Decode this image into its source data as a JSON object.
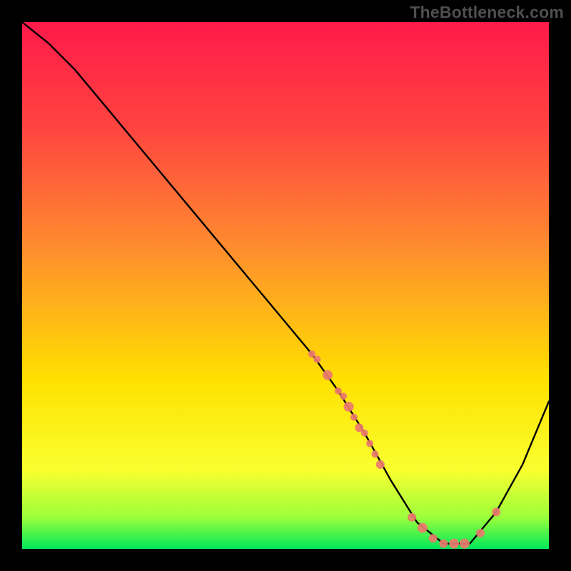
{
  "watermark": "TheBottleneck.com",
  "chart_data": {
    "type": "line",
    "title": "",
    "xlabel": "",
    "ylabel": "",
    "xlim": [
      0,
      100
    ],
    "ylim": [
      0,
      100
    ],
    "grid": false,
    "legend": false,
    "background_gradient": {
      "top_color": "#ff1a4a",
      "mid_color": "#ffe100",
      "bottom_color": "#00e85a"
    },
    "series": [
      {
        "name": "bottleneck-curve",
        "color": "#000000",
        "x": [
          0,
          5,
          10,
          15,
          20,
          25,
          30,
          35,
          40,
          45,
          50,
          55,
          60,
          65,
          70,
          75,
          80,
          85,
          90,
          95,
          100
        ],
        "y": [
          100,
          96,
          91,
          85,
          79,
          73,
          67,
          61,
          55,
          49,
          43,
          37,
          30,
          22,
          13,
          5,
          1,
          1,
          7,
          16,
          28
        ]
      }
    ],
    "scatter_points": {
      "name": "data-markers",
      "color": "#ea7a6e",
      "x": [
        55,
        56,
        58,
        60,
        61,
        62,
        63,
        64,
        65,
        66,
        67,
        68,
        74,
        76,
        78,
        80,
        82,
        84,
        87,
        90
      ],
      "y": [
        37,
        36,
        33,
        30,
        29,
        27,
        25,
        23,
        22,
        20,
        18,
        16,
        6,
        4,
        2,
        1,
        1,
        1,
        3,
        7
      ],
      "radius": [
        5,
        5,
        7,
        5,
        5,
        7,
        5,
        6,
        5,
        5,
        5,
        6,
        6,
        7,
        6,
        6,
        7,
        7,
        6,
        6
      ]
    }
  },
  "colors": {
    "black": "#000000",
    "marker": "#ea7a6e",
    "grad_top": "#ff1a4a",
    "grad_red2": "#ff4440",
    "grad_orange": "#ff8a2f",
    "grad_yellow": "#ffe100",
    "grad_yellow2": "#faff2f",
    "grad_green1": "#9cff3b",
    "grad_green2": "#00e85a"
  }
}
